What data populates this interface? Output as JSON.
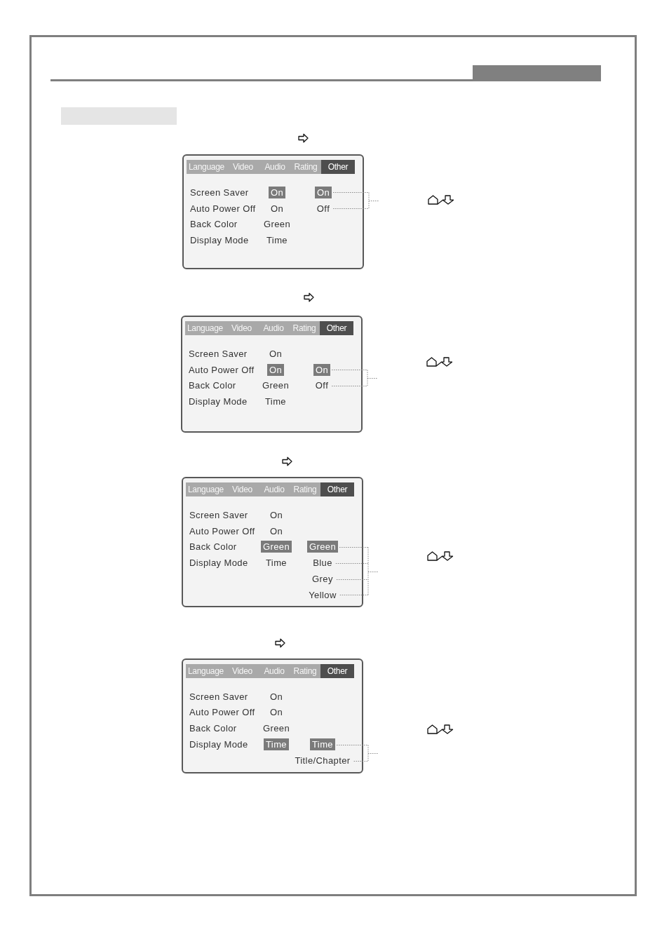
{
  "sections": [
    {
      "screen": {
        "tabs": [
          {
            "label": "Language",
            "selected": false
          },
          {
            "label": "Video",
            "selected": false
          },
          {
            "label": "Audio",
            "selected": false
          },
          {
            "label": "Rating",
            "selected": false
          },
          {
            "label": "Other",
            "selected": true
          }
        ],
        "settings": [
          {
            "label": "Screen Saver",
            "value": "On",
            "selected": true
          },
          {
            "label": "Auto Power Off",
            "value": "On",
            "selected": false
          },
          {
            "label": "Back Color",
            "value": "Green",
            "selected": false
          },
          {
            "label": "Display Mode",
            "value": "Time",
            "selected": false
          }
        ],
        "options": [
          {
            "label": "On",
            "selected": true
          },
          {
            "label": "Off",
            "selected": false
          }
        ]
      }
    },
    {
      "screen": {
        "tabs": [
          {
            "label": "Language",
            "selected": false
          },
          {
            "label": "Video",
            "selected": false
          },
          {
            "label": "Audio",
            "selected": false
          },
          {
            "label": "Rating",
            "selected": false
          },
          {
            "label": "Other",
            "selected": true
          }
        ],
        "settings": [
          {
            "label": "Screen Saver",
            "value": "On",
            "selected": false
          },
          {
            "label": "Auto Power Off",
            "value": "On",
            "selected": true
          },
          {
            "label": "Back Color",
            "value": "Green",
            "selected": false
          },
          {
            "label": "Display Mode",
            "value": "Time",
            "selected": false
          }
        ],
        "options": [
          {
            "label": "On",
            "selected": true
          },
          {
            "label": "Off",
            "selected": false
          }
        ]
      }
    },
    {
      "screen": {
        "tabs": [
          {
            "label": "Language",
            "selected": false
          },
          {
            "label": "Video",
            "selected": false
          },
          {
            "label": "Audio",
            "selected": false
          },
          {
            "label": "Rating",
            "selected": false
          },
          {
            "label": "Other",
            "selected": true
          }
        ],
        "settings": [
          {
            "label": "Screen Saver",
            "value": "On",
            "selected": false
          },
          {
            "label": "Auto Power Off",
            "value": "On",
            "selected": false
          },
          {
            "label": "Back Color",
            "value": "Green",
            "selected": true
          },
          {
            "label": "Display Mode",
            "value": "Time",
            "selected": false
          }
        ],
        "options": [
          {
            "label": "Green",
            "selected": true
          },
          {
            "label": "Blue",
            "selected": false
          },
          {
            "label": "Grey",
            "selected": false
          },
          {
            "label": "Yellow",
            "selected": false
          }
        ]
      }
    },
    {
      "screen": {
        "tabs": [
          {
            "label": "Language",
            "selected": false
          },
          {
            "label": "Video",
            "selected": false
          },
          {
            "label": "Audio",
            "selected": false
          },
          {
            "label": "Rating",
            "selected": false
          },
          {
            "label": "Other",
            "selected": true
          }
        ],
        "settings": [
          {
            "label": "Screen Saver",
            "value": "On",
            "selected": false
          },
          {
            "label": "Auto Power Off",
            "value": "On",
            "selected": false
          },
          {
            "label": "Back Color",
            "value": "Green",
            "selected": false
          },
          {
            "label": "Display Mode",
            "value": "Time",
            "selected": true
          }
        ],
        "options": [
          {
            "label": "Time",
            "selected": true
          },
          {
            "label": "Title/Chapter",
            "selected": false
          }
        ]
      }
    }
  ]
}
